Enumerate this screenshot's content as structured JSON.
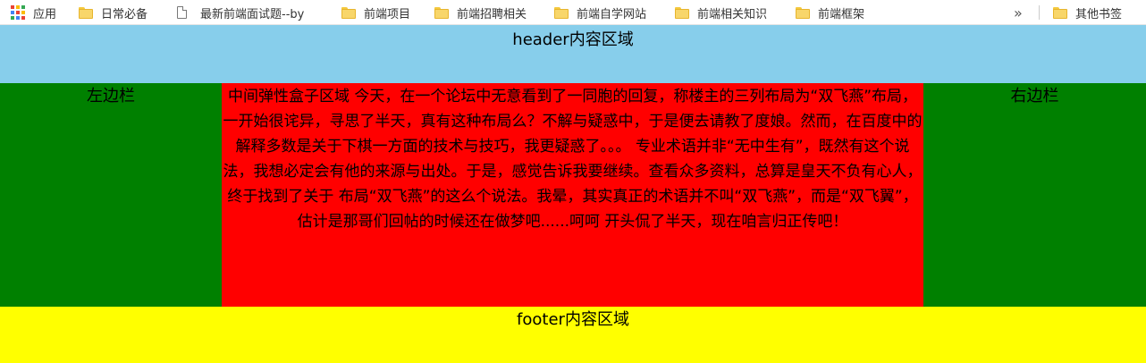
{
  "bookmarks_bar": {
    "apps_label": "应用",
    "items": [
      {
        "label": "日常必备",
        "icon": "folder-icon"
      },
      {
        "label": "最新前端面试题--by",
        "icon": "page-icon"
      },
      {
        "label": "前端项目",
        "icon": "folder-icon"
      },
      {
        "label": "前端招聘相关",
        "icon": "folder-icon"
      },
      {
        "label": "前端自学网站",
        "icon": "folder-icon"
      },
      {
        "label": "前端相关知识",
        "icon": "folder-icon"
      },
      {
        "label": "前端框架",
        "icon": "folder-icon"
      }
    ],
    "overflow": "»",
    "other_bookmarks_label": "其他书签"
  },
  "colors": {
    "header_bg": "#87ceeb",
    "side_bg": "#008000",
    "center_bg": "#ff0000",
    "footer_bg": "#ffff00"
  },
  "layout_text": {
    "header": "header内容区域",
    "left_sidebar": "左边栏",
    "right_sidebar": "右边栏",
    "center": "中间弹性盒子区域 今天，在一个论坛中无意看到了一同胞的回复，称楼主的三列布局为“双飞燕”布局，一开始很诧异，寻思了半天，真有这种布局么？不解与疑惑中，于是便去请教了度娘。然而，在百度中的解释多数是关于下棋一方面的技术与技巧，我更疑惑了。。。 专业术语并非“无中生有”，既然有这个说法，我想必定会有他的来源与出处。于是，感觉告诉我要继续。查看众多资料，总算是皇天不负有心人，终于找到了关于 布局“双飞燕”的这么个说法。我晕，其实真正的术语并不叫“双飞燕”，而是“双飞翼”，估计是那哥们回帖的时候还在做梦吧......呵呵 开头侃了半天，现在咱言归正传吧！",
    "footer": "footer内容区域"
  }
}
